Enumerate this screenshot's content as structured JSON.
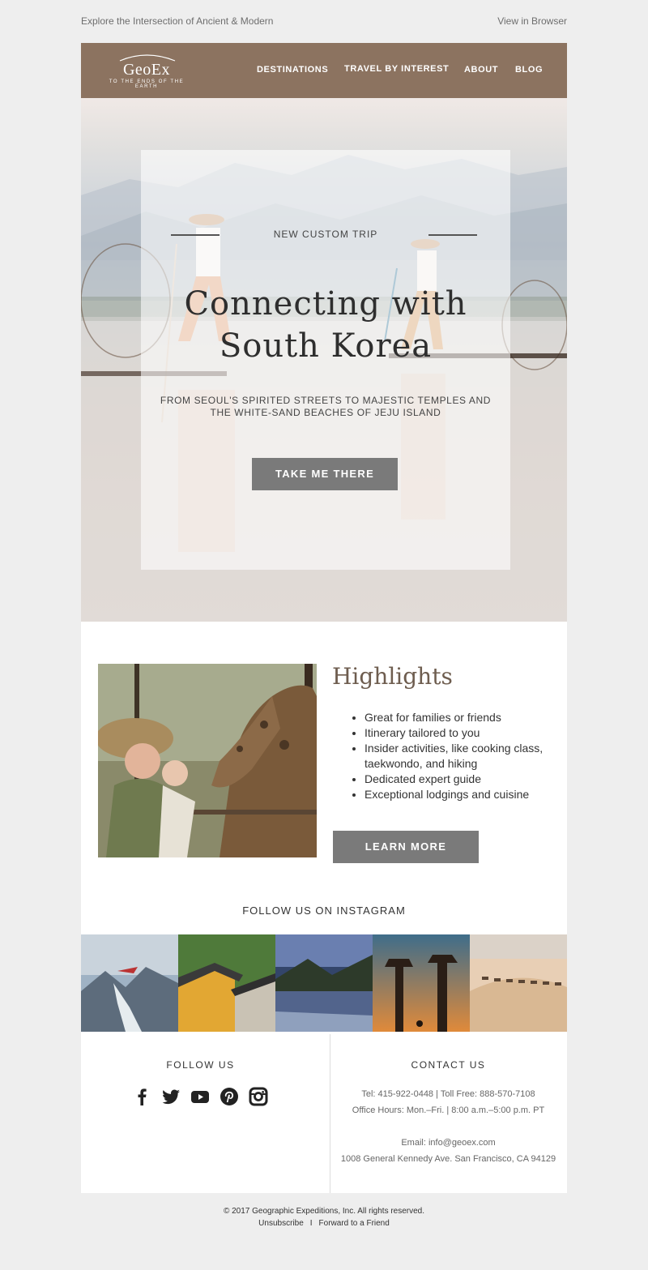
{
  "preheader": {
    "tagline": "Explore the Intersection of Ancient & Modern",
    "view_in_browser": "View in Browser"
  },
  "brand": {
    "name": "GeoEx",
    "tagline": "TO THE ENDS OF THE EARTH",
    "color": "#8c7360"
  },
  "nav": {
    "items": [
      {
        "label": "DESTINATIONS"
      },
      {
        "label": "TRAVEL BY INTEREST"
      },
      {
        "label": "ABOUT"
      },
      {
        "label": "BLOG"
      }
    ]
  },
  "hero": {
    "eyebrow": "NEW CUSTOM TRIP",
    "title_line1": "Connecting with",
    "title_line2": "South Korea",
    "subtitle_line1": "FROM SEOUL'S SPIRITED STREETS TO MAJESTIC TEMPLES AND",
    "subtitle_line2": "THE WHITE-SAND BEACHES OF JEJU ISLAND",
    "cta": "TAKE ME THERE"
  },
  "highlights": {
    "title": "Highlights",
    "items": [
      {
        "text": "Great for families or friends"
      },
      {
        "text": "Itinerary tailored to you"
      },
      {
        "text": "Insider activities, like cooking class, taekwondo, and hiking"
      },
      {
        "text": "Dedicated expert guide"
      },
      {
        "text": "Exceptional lodgings and cuisine"
      }
    ],
    "cta": "LEARN MORE"
  },
  "instagram": {
    "title": "FOLLOW US ON INSTAGRAM",
    "tiles": [
      {
        "icon": "mountain-glacier-photo"
      },
      {
        "icon": "temple-photo"
      },
      {
        "icon": "lake-photo"
      },
      {
        "icon": "baobab-photo"
      },
      {
        "icon": "desert-camels-photo"
      }
    ]
  },
  "follow": {
    "title": "FOLLOW US",
    "icons": [
      "facebook-icon",
      "twitter-icon",
      "youtube-icon",
      "pinterest-icon",
      "instagram-icon"
    ]
  },
  "contact": {
    "title": "CONTACT US",
    "phone": "Tel: 415-922-0448 | Toll Free: 888-570-7108",
    "hours": "Office Hours: Mon.–Fri. | 8:00 a.m.–5:00 p.m. PT",
    "email": "Email: info@geoex.com",
    "address": "1008 General Kennedy Ave. San Francisco, CA 94129"
  },
  "footer": {
    "copyright": "© 2017 Geographic Expeditions, Inc. All rights reserved.",
    "unsubscribe": "Unsubscribe",
    "separator": "I",
    "forward": "Forward to a Friend"
  },
  "colors": {
    "button": "#7a7a7a",
    "background": "#eeeeee",
    "highlight_title": "#6e5d4f"
  }
}
